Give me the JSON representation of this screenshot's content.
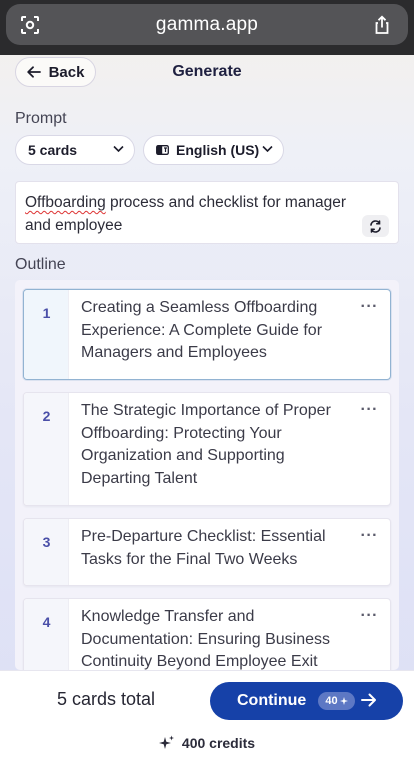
{
  "browser": {
    "url": "gamma.app"
  },
  "header": {
    "back_label": "Back",
    "title": "Generate"
  },
  "prompt": {
    "label": "Prompt",
    "cards_select": "5 cards",
    "language_select": "English (US)",
    "text_misspelled": "Offboarding",
    "text_rest": " process and checklist for manager and employee"
  },
  "outline": {
    "label": "Outline",
    "more_label": "···",
    "cards": [
      {
        "number": "1",
        "title": "Creating a Seamless Offboarding Experience: A Complete Guide for Managers and Employees"
      },
      {
        "number": "2",
        "title": "The Strategic Importance of Proper Offboarding: Protecting Your Organization and Supporting Departing Talent"
      },
      {
        "number": "3",
        "title": "Pre-Departure Checklist: Essential Tasks for the Final Two Weeks"
      },
      {
        "number": "4",
        "title": "Knowledge Transfer and Documentation: Ensuring Business Continuity Beyond Employee Exit"
      }
    ]
  },
  "footer": {
    "total": "5 cards total",
    "continue_label": "Continue",
    "continue_cost": "40",
    "credits": "400 credits"
  },
  "colors": {
    "accent": "#1641a8",
    "number": "#4a4fa8",
    "active_border": "#92b3d2"
  }
}
